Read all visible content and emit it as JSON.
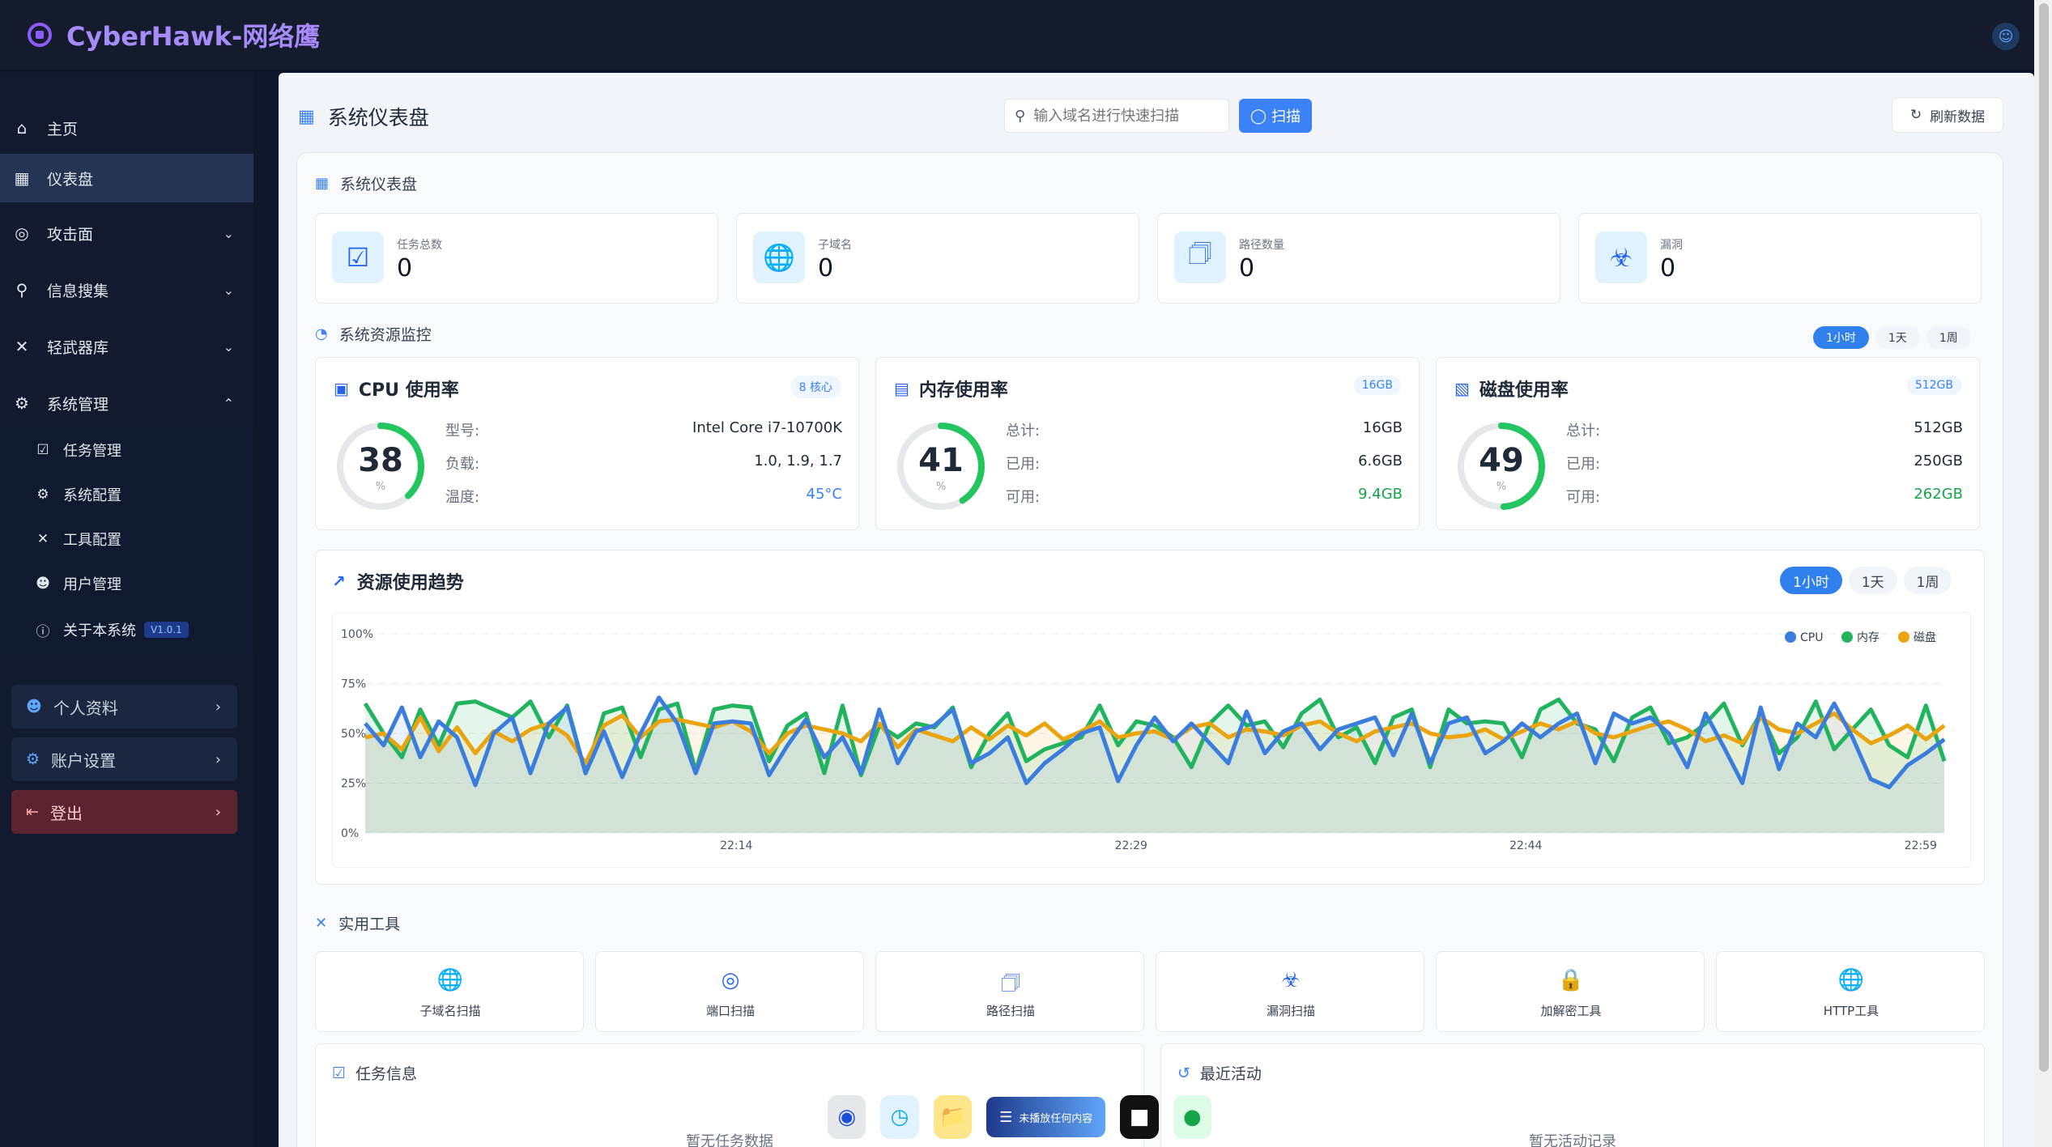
{
  "app": {
    "title": "CyberHawk-网络鹰"
  },
  "sidebar": {
    "items": [
      {
        "label": "主页"
      },
      {
        "label": "仪表盘"
      },
      {
        "label": "攻击面"
      },
      {
        "label": "信息搜集"
      },
      {
        "label": "轻武器库"
      },
      {
        "label": "系统管理"
      }
    ],
    "sub_items": [
      {
        "label": "任务管理"
      },
      {
        "label": "系统配置"
      },
      {
        "label": "工具配置"
      },
      {
        "label": "用户管理"
      },
      {
        "label": "关于本系统",
        "badge": "V1.0.1"
      }
    ],
    "cards": [
      {
        "label": "个人资料"
      },
      {
        "label": "账户设置"
      },
      {
        "label": "登出"
      }
    ]
  },
  "header": {
    "page_title": "系统仪表盘",
    "search_placeholder": "输入域名进行快速扫描",
    "scan_label": "扫描",
    "refresh_label": "刷新数据"
  },
  "dashboard": {
    "section_title": "系统仪表盘",
    "stats": [
      {
        "label": "任务总数",
        "value": "0",
        "icon": "checkbox-icon"
      },
      {
        "label": "子域名",
        "value": "0",
        "icon": "globe-icon"
      },
      {
        "label": "路径数量",
        "value": "0",
        "icon": "folders-icon"
      },
      {
        "label": "漏洞",
        "value": "0",
        "icon": "bug-icon"
      }
    ]
  },
  "monitor": {
    "section_title": "系统资源监控",
    "ranges": [
      "1小时",
      "1天",
      "1周"
    ],
    "cpu": {
      "title": "CPU 使用率",
      "badge": "8 核心",
      "percent": 38,
      "unit": "%",
      "rows": [
        {
          "k": "型号:",
          "v": "Intel Core i7-10700K"
        },
        {
          "k": "负载:",
          "v": "1.0, 1.9, 1.7"
        },
        {
          "k": "温度:",
          "v": "45°C"
        }
      ]
    },
    "memory": {
      "title": "内存使用率",
      "badge": "16GB",
      "percent": 41,
      "unit": "%",
      "rows": [
        {
          "k": "总计:",
          "v": "16GB"
        },
        {
          "k": "已用:",
          "v": "6.6GB"
        },
        {
          "k": "可用:",
          "v": "9.4GB"
        }
      ]
    },
    "disk": {
      "title": "磁盘使用率",
      "badge": "512GB",
      "percent": 49,
      "unit": "%",
      "rows": [
        {
          "k": "总计:",
          "v": "512GB"
        },
        {
          "k": "已用:",
          "v": "250GB"
        },
        {
          "k": "可用:",
          "v": "262GB"
        }
      ]
    }
  },
  "trend": {
    "title": "资源使用趋势",
    "ranges": [
      "1小时",
      "1天",
      "1周"
    ]
  },
  "chart_data": {
    "type": "line",
    "title": "资源使用趋势",
    "x_tick_labels": [
      "22:14",
      "22:29",
      "22:44",
      "22:59"
    ],
    "y_tick_labels": [
      "100%",
      "75%",
      "50%",
      "25%",
      "0%"
    ],
    "ylim": [
      0,
      100
    ],
    "grid": true,
    "legend_position": "top-right",
    "series": [
      {
        "name": "CPU",
        "color": "#3b7ddd",
        "values": [
          55,
          44,
          63,
          38,
          56,
          48,
          24,
          50,
          58,
          30,
          55,
          63,
          30,
          51,
          28,
          50,
          68,
          55,
          30,
          55,
          56,
          55,
          29,
          44,
          57,
          38,
          48,
          30,
          62,
          35,
          51,
          54,
          62,
          35,
          40,
          48,
          25,
          35,
          42,
          50,
          53,
          26,
          44,
          58,
          46,
          55,
          45,
          35,
          61,
          40,
          51,
          55,
          42,
          52,
          55,
          58,
          39,
          60,
          35,
          55,
          58,
          40,
          46,
          55,
          48,
          55,
          60,
          35,
          60,
          55,
          58,
          50,
          33,
          60,
          43,
          25,
          63,
          32,
          55,
          48,
          65,
          48,
          27,
          23,
          34,
          40,
          47
        ]
      },
      {
        "name": "内存",
        "color": "#22b35e",
        "values": [
          65,
          50,
          38,
          62,
          44,
          65,
          66,
          62,
          58,
          66,
          48,
          64,
          30,
          60,
          63,
          38,
          62,
          65,
          31,
          62,
          64,
          63,
          36,
          54,
          60,
          30,
          64,
          29,
          54,
          48,
          55,
          53,
          63,
          33,
          50,
          60,
          36,
          42,
          45,
          48,
          64,
          44,
          56,
          54,
          48,
          33,
          55,
          64,
          54,
          56,
          43,
          60,
          67,
          48,
          53,
          35,
          58,
          62,
          33,
          62,
          55,
          56,
          55,
          38,
          62,
          67,
          55,
          52,
          36,
          58,
          63,
          45,
          48,
          55,
          65,
          44,
          60,
          40,
          48,
          66,
          42,
          52,
          62,
          44,
          38,
          64,
          36
        ]
      },
      {
        "name": "磁盘",
        "color": "#e9a40f",
        "values": [
          48,
          50,
          42,
          58,
          41,
          53,
          40,
          51,
          46,
          52,
          55,
          49,
          35,
          54,
          59,
          48,
          56,
          57,
          55,
          53,
          56,
          51,
          40,
          50,
          54,
          52,
          50,
          46,
          55,
          43,
          52,
          49,
          46,
          53,
          47,
          54,
          49,
          55,
          47,
          51,
          56,
          48,
          50,
          51,
          47,
          53,
          55,
          48,
          52,
          51,
          49,
          54,
          56,
          50,
          46,
          51,
          53,
          55,
          50,
          48,
          49,
          52,
          47,
          51,
          55,
          52,
          56,
          50,
          48,
          51,
          54,
          56,
          52,
          46,
          49,
          45,
          58,
          52,
          50,
          55,
          60,
          52,
          45,
          49,
          54,
          47,
          54
        ]
      }
    ]
  },
  "tools": {
    "section_title": "实用工具",
    "items": [
      {
        "label": "子域名扫描",
        "icon": "globe-icon"
      },
      {
        "label": "端口扫描",
        "icon": "radar-icon"
      },
      {
        "label": "路径扫描",
        "icon": "folders-icon"
      },
      {
        "label": "漏洞扫描",
        "icon": "bug-icon"
      },
      {
        "label": "加解密工具",
        "icon": "lock-icon"
      },
      {
        "label": "HTTP工具",
        "icon": "globe-icon"
      }
    ]
  },
  "task_info": {
    "title": "任务信息",
    "empty": "暂无任务数据"
  },
  "activity": {
    "title": "最近活动",
    "empty": "暂无活动记录"
  },
  "dock": {
    "player_label": "未播放任何内容"
  }
}
